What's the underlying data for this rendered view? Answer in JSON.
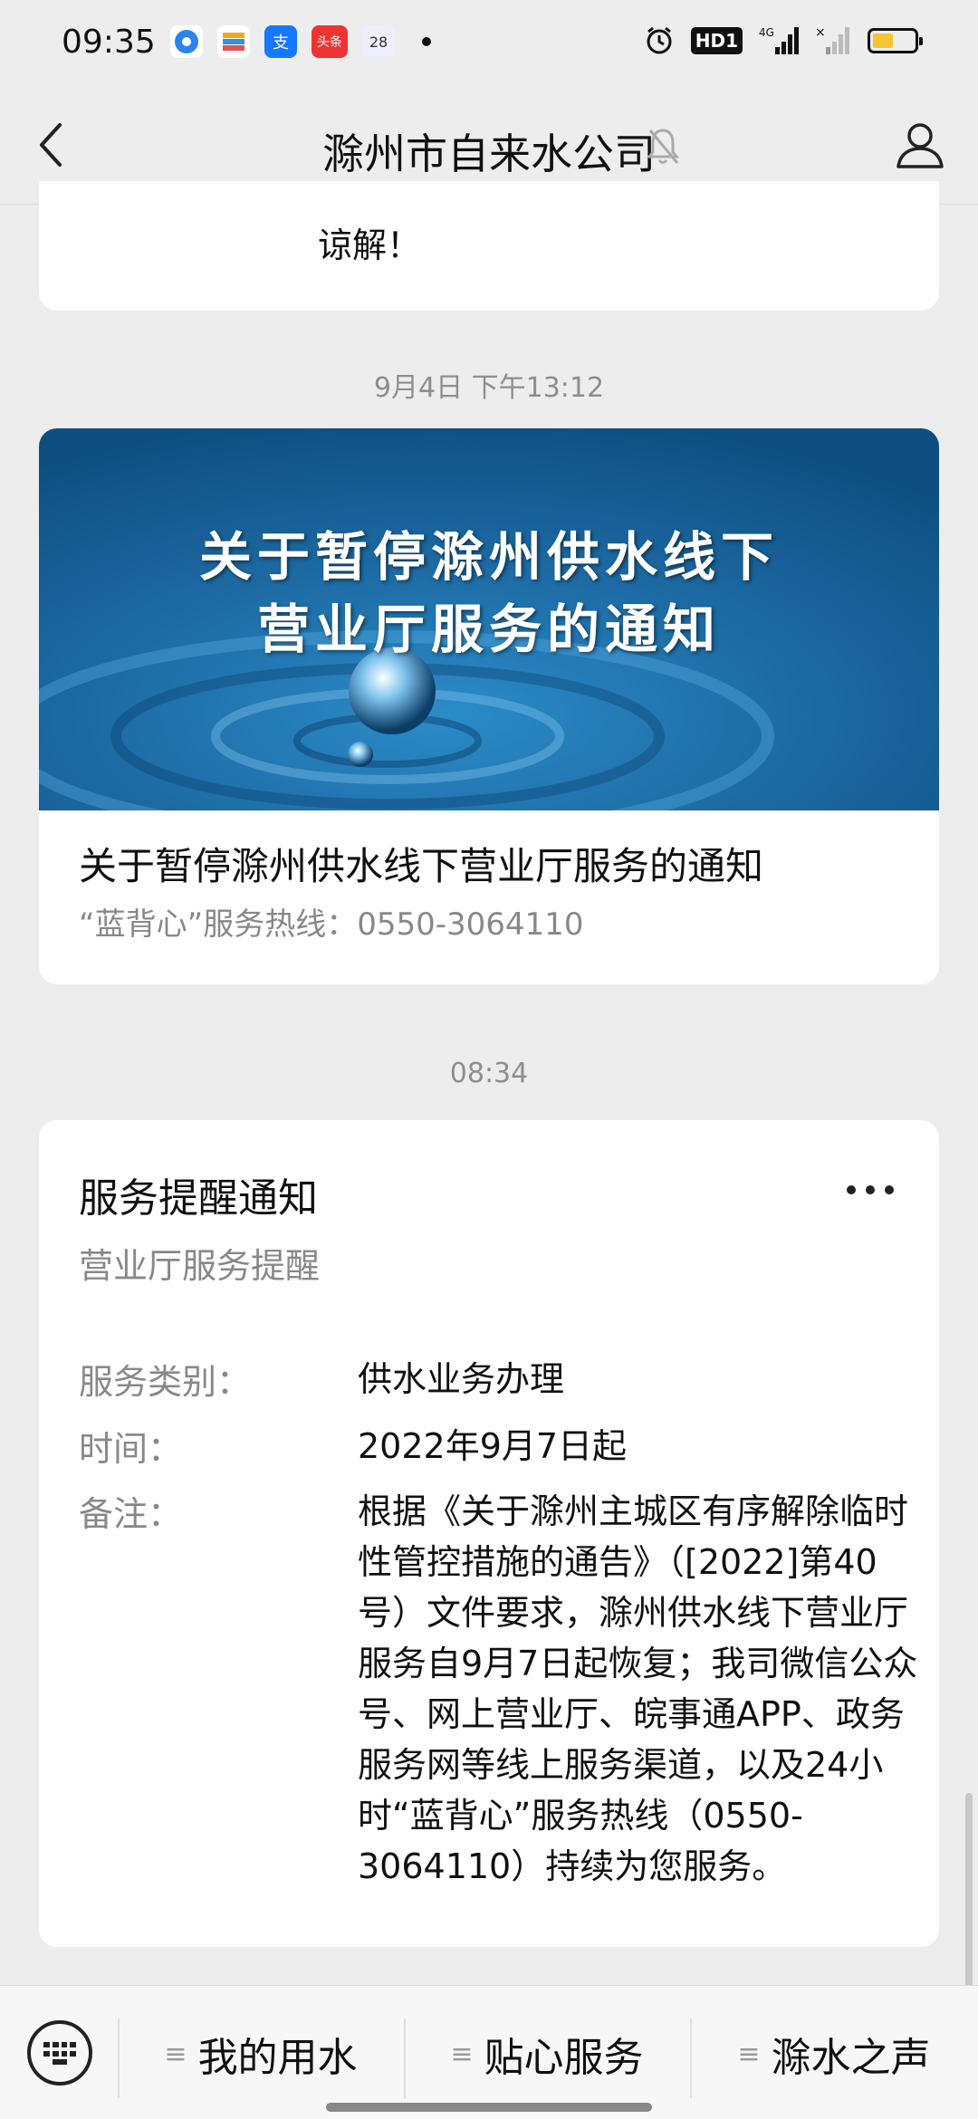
{
  "status_bar": {
    "time": "09:35",
    "calendar_badge": "28",
    "toutiao_badge": "头条",
    "alipay_badge": "支",
    "hd_label": "HD1",
    "network_label": "4G"
  },
  "header": {
    "title": "滁州市自来水公司",
    "back_icon": "chevron-left-icon",
    "mute_icon": "bell-off-icon",
    "profile_icon": "user-icon"
  },
  "messages": {
    "prev_card_tail": "谅解！",
    "timestamp_1": "9月4日 下午13:12",
    "article": {
      "banner_line1": "关于暂停滁州供水线下",
      "banner_line2": "营业厅服务的通知",
      "title": "关于暂停滁州供水线下营业厅服务的通知",
      "subtitle": "“蓝背心”服务热线：0550-3064110"
    },
    "timestamp_2": "08:34",
    "notice": {
      "title": "服务提醒通知",
      "subtitle": "营业厅服务提醒",
      "rows": [
        {
          "label": "服务类别：",
          "value": "供水业务办理"
        },
        {
          "label": "时间：",
          "value": "2022年9月7日起"
        },
        {
          "label": "备注：",
          "value": "根据《关于滁州主城区有序解除临时性管控措施的通告》（[2022]第40号）文件要求，滁州供水线下营业厅服务自9月7日起恢复；我司微信公众号、网上营业厅、皖事通APP、政务服务网等线上服务渠道，以及24小时“蓝背心”服务热线（0550-3064110）持续为您服务。"
        }
      ]
    }
  },
  "bottom_menu": {
    "items": [
      {
        "label": "我的用水"
      },
      {
        "label": "贴心服务"
      },
      {
        "label": "滁水之声"
      }
    ],
    "menu_glyph": "≡"
  },
  "colors": {
    "background": "#ededed",
    "card": "#ffffff",
    "muted_text": "#888888",
    "banner_blue": "#1f6aa0"
  }
}
